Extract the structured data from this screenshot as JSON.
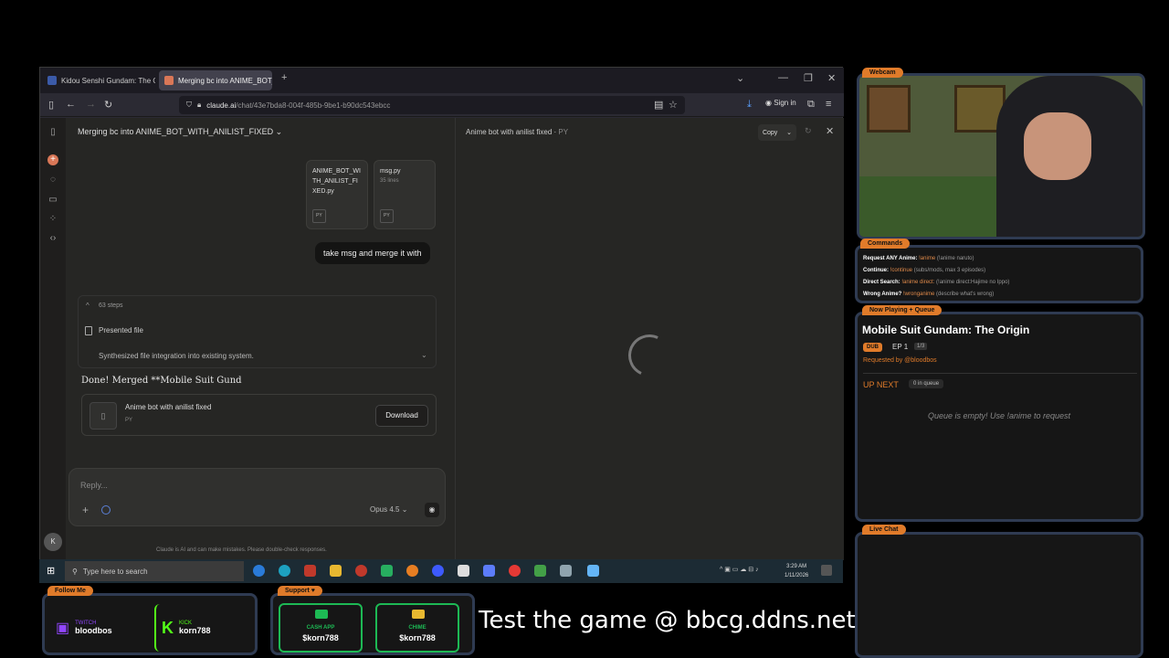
{
  "browser": {
    "tabs": [
      {
        "label": "Kidou Senshi Gundam: The Origi"
      },
      {
        "label": "Merging bc into ANIME_BOT_W"
      }
    ],
    "url_host": "claude.ai",
    "url_path": "/chat/43e7bda8-004f-485b-9be1-b90dc543ebcc",
    "signin_label": "Sign in"
  },
  "chat": {
    "title": "Merging bc into ANIME_BOT_WITH_ANILIST_FIXED",
    "files": [
      {
        "name": "ANIME_BOT_WITH_ANILIST_FIXED.py",
        "sub": "",
        "type": "PY"
      },
      {
        "name": "msg.py",
        "sub": "35 lines",
        "type": "PY"
      }
    ],
    "user_message": "take msg and merge it with",
    "steps_count": "63 steps",
    "presented": "Presented file",
    "synth": "Synthesized file integration into existing system.",
    "done_text": "Done! Merged **Mobile Suit Gund",
    "artifact_name": "Anime bot with anilist fixed",
    "artifact_type": "PY",
    "download_label": "Download",
    "reply_placeholder": "Reply...",
    "model": "Opus 4.5",
    "disclaimer": "Claude is AI and can make mistakes. Please double-check responses.",
    "avatar_letter": "K"
  },
  "artifact_panel": {
    "title": "Anime bot with anilist fixed",
    "type": "PY",
    "copy_label": "Copy"
  },
  "taskbar": {
    "search_placeholder": "Type here to search",
    "time": "3:29 AM",
    "date": "1/11/2026"
  },
  "overlay": {
    "webcam_label": "Webcam",
    "commands_label": "Commands",
    "commands": [
      {
        "label": "Request ANY Anime:",
        "cmd": "!anime",
        "desc": "(!anime naruto)"
      },
      {
        "label": "Continue:",
        "cmd": "!continue",
        "desc": "(subs/mods, max 3 episodes)"
      },
      {
        "label": "Direct Search:",
        "cmd": "!anime direct:",
        "desc": "(!anime direct:Hajime no Ippo)"
      },
      {
        "label": "Wrong Anime?",
        "cmd": "!wronganime",
        "desc": "(describe what's wrong)"
      }
    ],
    "now_playing_label": "Now Playing + Queue",
    "now_playing_title": "Mobile Suit Gundam: The Origin",
    "dub": "DUB",
    "episode": "EP 1",
    "episode_of": "1/3",
    "requested_by": "Requested by @bloodbos",
    "up_next": "UP NEXT",
    "in_queue": "0 in queue",
    "queue_empty": "Queue is empty! Use !anime to request",
    "live_chat_label": "Live Chat",
    "follow_label": "Follow Me",
    "twitch_label": "TWITCH",
    "twitch_user": "bloodbos",
    "kick_label": "KICK",
    "kick_user": "korn788",
    "support_label": "Support",
    "cashapp_label": "CASH APP",
    "cashapp_user": "$korn788",
    "chime_label": "CHIME",
    "chime_user": "$korn788",
    "banner": "Test the game @ bbcg.ddns.net"
  }
}
